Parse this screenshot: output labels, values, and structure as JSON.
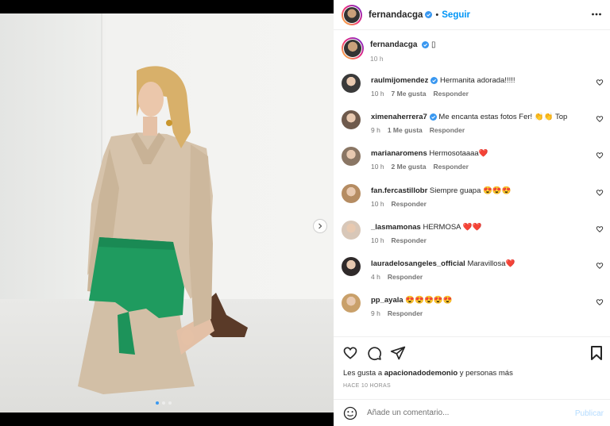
{
  "post": {
    "username": "fernandacga",
    "follow_label": "Seguir",
    "separator": "•",
    "caption_text": "▯",
    "caption_time": "10 h"
  },
  "comments": [
    {
      "username": "raulmijomendez",
      "verified": true,
      "text": "Hermanita adorada!!!!!",
      "time": "10 h",
      "likes": "7 Me gusta",
      "reply": "Responder",
      "avatar_color": "#3a3a3a"
    },
    {
      "username": "ximenaherrera7",
      "verified": true,
      "text": "Me encanta estas fotos Fer! 👏👏 Top",
      "time": "9 h",
      "likes": "1 Me gusta",
      "reply": "Responder",
      "avatar_color": "#6e5a4c"
    },
    {
      "username": "marianaromens",
      "verified": false,
      "text": "Hermosotaaaa❤️",
      "time": "10 h",
      "likes": "2 Me gusta",
      "reply": "Responder",
      "avatar_color": "#8a7664"
    },
    {
      "username": "fan.fercastillobr",
      "verified": false,
      "text": "Siempre guapa 😍😍😍",
      "time": "10 h",
      "likes": "",
      "reply": "Responder",
      "avatar_color": "#b58c62"
    },
    {
      "username": "_lasmamonas",
      "verified": false,
      "text": "HERMOSA ❤️❤️",
      "time": "10 h",
      "likes": "",
      "reply": "Responder",
      "avatar_color": "#d8c7b8"
    },
    {
      "username": "lauradelosangeles_official",
      "verified": false,
      "text": "Maravillosa❤️",
      "time": "4 h",
      "likes": "",
      "reply": "Responder",
      "avatar_color": "#2f2a2a"
    },
    {
      "username": "pp_ayala",
      "verified": false,
      "text": "😍😍😍😍😍",
      "time": "9 h",
      "likes": "",
      "reply": "Responder",
      "avatar_color": "#c9a06a"
    }
  ],
  "actions": {
    "likes_prefix": "Les gusta a",
    "liked_by": "apacionadodemonio",
    "likes_suffix": "y personas más",
    "time_ago": "HACE 10 HORAS"
  },
  "composer": {
    "placeholder": "Añade un comentario...",
    "post_label": "Publicar"
  },
  "colors": {
    "accent": "#0095f6",
    "verified": "#3897f0",
    "skirt": "#1f9b5f",
    "coat": "#d6c3ab"
  },
  "carousel": {
    "total_slides": 3,
    "active_slide": 1
  }
}
